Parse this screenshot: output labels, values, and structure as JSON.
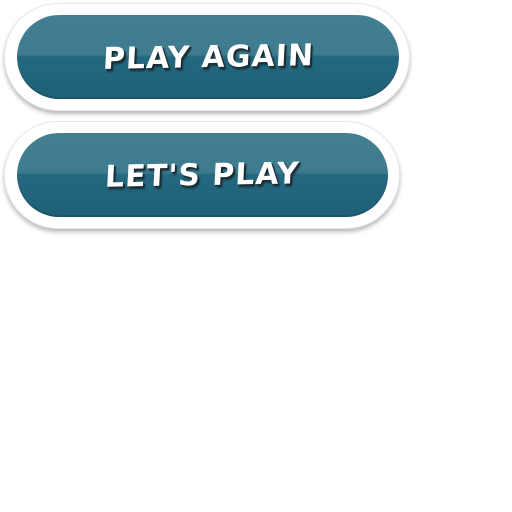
{
  "buttons": {
    "play_again": {
      "label": "PLAY AGAIN"
    },
    "lets_play": {
      "label": "LET'S PLAY"
    }
  },
  "colors": {
    "button_face_top": "#437f91",
    "button_face_bottom": "#1f6177",
    "button_frame": "#ffffff",
    "label_text": "#ffffff",
    "label_outline": "#1b2d35"
  }
}
